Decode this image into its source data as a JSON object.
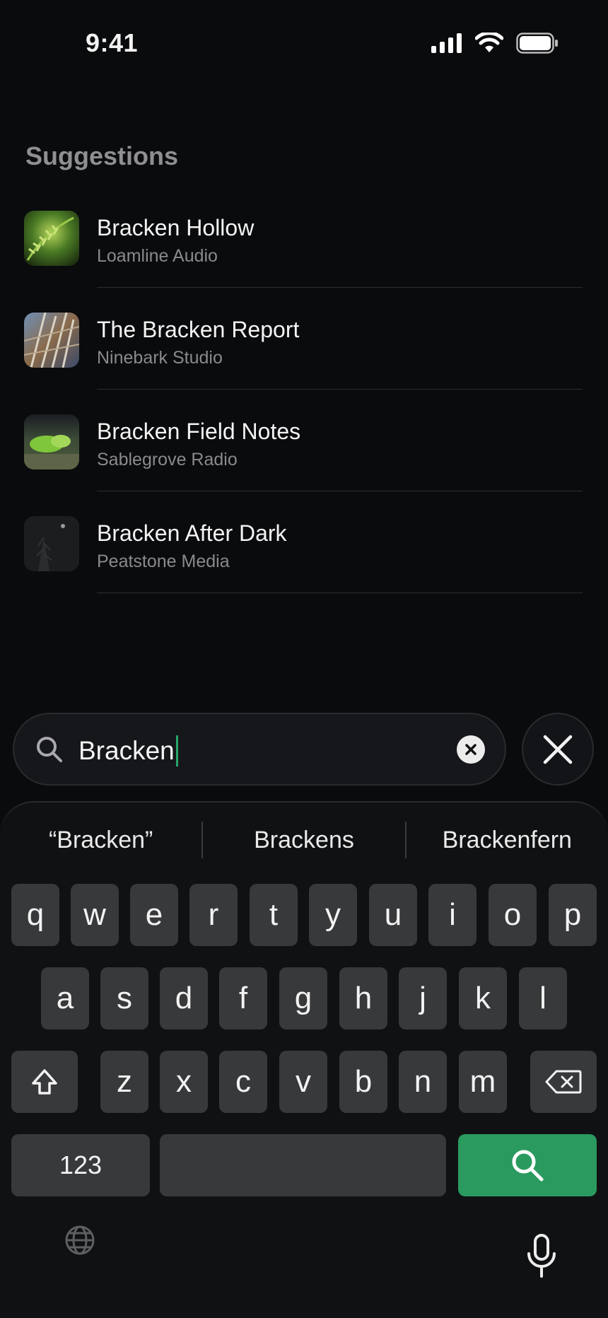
{
  "status_bar": {
    "time": "9:41"
  },
  "section_title": "Suggestions",
  "suggestions": [
    {
      "title": "Bracken Hollow",
      "subtitle": "Loamline Audio"
    },
    {
      "title": "The Bracken Report",
      "subtitle": "Ninebark Studio"
    },
    {
      "title": "Bracken Field Notes",
      "subtitle": "Sablegrove Radio"
    },
    {
      "title": "Bracken After Dark",
      "subtitle": "Peatstone Media"
    }
  ],
  "search": {
    "value": "Bracken"
  },
  "predictions": [
    "“Bracken”",
    "Brackens",
    "Brackenfern"
  ],
  "keyboard": {
    "row1": [
      "q",
      "w",
      "e",
      "r",
      "t",
      "y",
      "u",
      "i",
      "o",
      "p"
    ],
    "row2": [
      "a",
      "s",
      "d",
      "f",
      "g",
      "h",
      "j",
      "k",
      "l"
    ],
    "row3": [
      "z",
      "x",
      "c",
      "v",
      "b",
      "n",
      "m"
    ],
    "numbers_key": "123"
  },
  "colors": {
    "accent": "#2a9a5f",
    "caret": "#2aa56a",
    "background": "#0a0b0d"
  },
  "icons": [
    "signal-icon",
    "wifi-icon",
    "battery-icon",
    "search-icon",
    "clear-icon",
    "close-icon",
    "shift-icon",
    "backspace-icon",
    "globe-icon",
    "microphone-icon"
  ]
}
